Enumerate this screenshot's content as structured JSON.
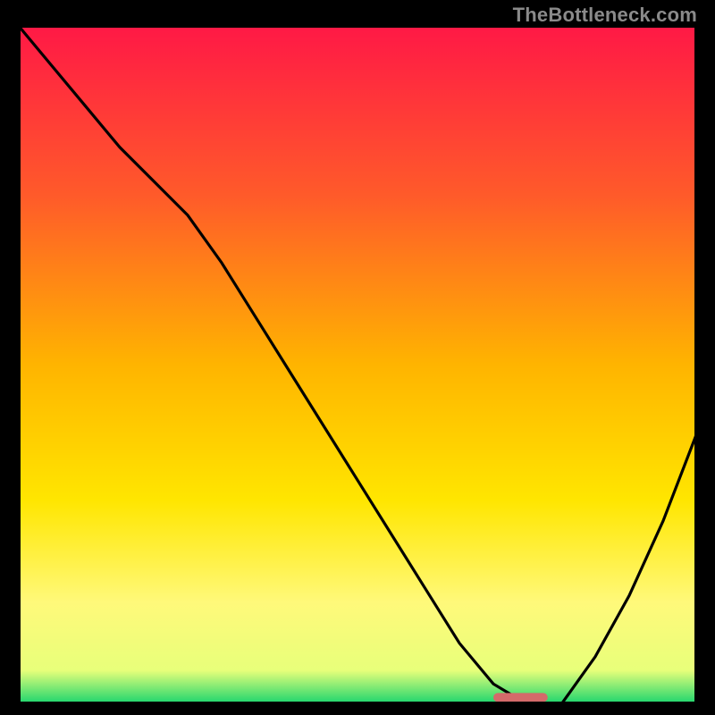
{
  "watermark": "TheBottleneck.com",
  "chart_data": {
    "type": "line",
    "title": "",
    "xlabel": "",
    "ylabel": "",
    "xlim": [
      0,
      100
    ],
    "ylim": [
      0,
      100
    ],
    "grid": false,
    "legend": false,
    "series": [
      {
        "name": "curve",
        "x": [
          0,
          5,
          10,
          15,
          20,
          25,
          30,
          35,
          40,
          45,
          50,
          55,
          60,
          65,
          70,
          75,
          80,
          85,
          90,
          95,
          100
        ],
        "values": [
          100,
          94,
          88,
          82,
          77,
          72,
          65,
          57,
          49,
          41,
          33,
          25,
          17,
          9,
          3,
          0,
          0,
          7,
          16,
          27,
          40
        ]
      }
    ],
    "marker": {
      "x_start": 70,
      "x_end": 78,
      "y": 1
    },
    "gradient_stops": [
      {
        "pct": 0,
        "color": "#ff1846"
      },
      {
        "pct": 25,
        "color": "#ff5a2a"
      },
      {
        "pct": 50,
        "color": "#ffb400"
      },
      {
        "pct": 70,
        "color": "#ffe600"
      },
      {
        "pct": 85,
        "color": "#fff97a"
      },
      {
        "pct": 95,
        "color": "#e8ff7a"
      },
      {
        "pct": 100,
        "color": "#18d46e"
      }
    ]
  }
}
